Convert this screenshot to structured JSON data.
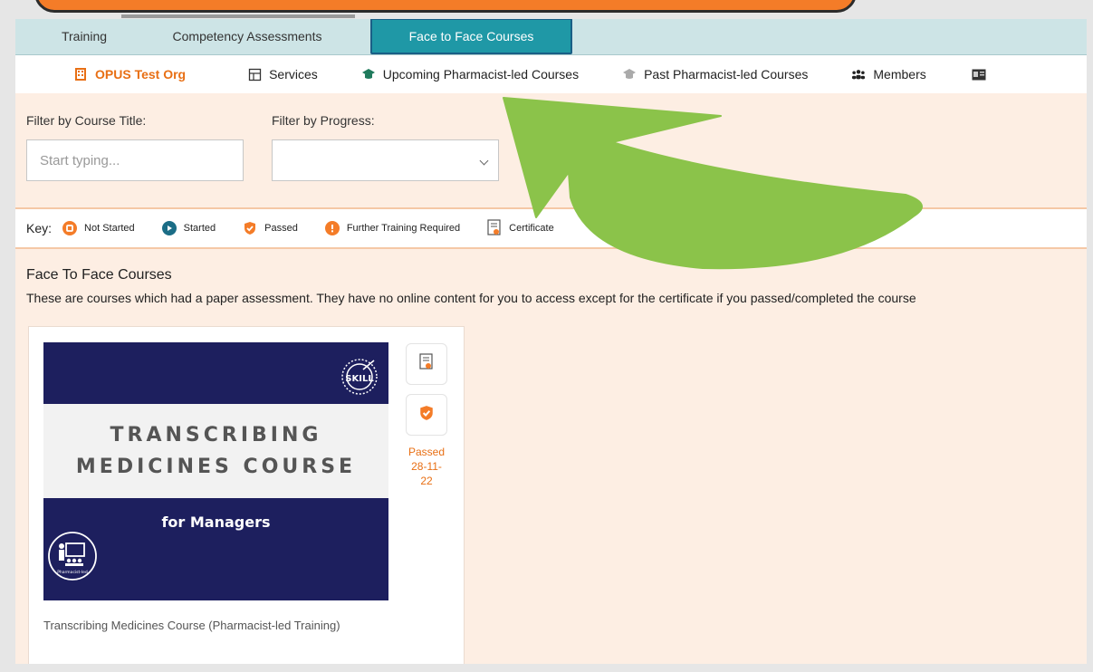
{
  "tabs": [
    {
      "label": "Training"
    },
    {
      "label": "Competency Assessments"
    },
    {
      "label": "Face to Face Courses"
    }
  ],
  "nav": {
    "org": "OPUS Test Org",
    "services": "Services",
    "upcoming": "Upcoming Pharmacist-led Courses",
    "past": "Past Pharmacist-led Courses",
    "members": "Members"
  },
  "filters": {
    "title_label": "Filter by Course Title:",
    "title_placeholder": "Start typing...",
    "progress_label": "Filter by Progress:"
  },
  "key": {
    "label": "Key:",
    "items": [
      "Not Started",
      "Started",
      "Passed",
      "Further Training Required",
      "Certificate"
    ]
  },
  "section": {
    "title": "Face To Face Courses",
    "description": "These are courses which had a paper assessment. They have no online content for you to access except for the certificate if you passed/completed the course"
  },
  "course": {
    "cover_line1": "TRANSCRIBING",
    "cover_line2": "MEDICINES COURSE",
    "cover_sub": "for Managers",
    "skill_label": "SKILL",
    "pharm_label": "Pharmacist-led",
    "status_line1": "Passed",
    "status_line2": "28-11-",
    "status_line3": "22",
    "caption": "Transcribing Medicines Course (Pharmacist-led Training)"
  },
  "colors": {
    "accent_orange": "#f47c28",
    "active_tab": "#1f98a6",
    "cover_navy": "#1d1f5e",
    "arrow_green": "#8bc34a"
  }
}
